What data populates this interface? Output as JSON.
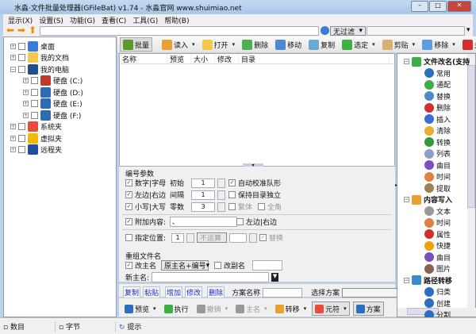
{
  "window": {
    "title": "水淼·文件批量处理器(GFileBat) v1.74 - 水淼官网 www.shuimiao.net"
  },
  "menu": [
    "显示(X)",
    "设置(S)",
    "功能(G)",
    "查看(C)",
    "工具(G)",
    "帮助(B)"
  ],
  "address": {
    "filter": "无过滤",
    "path": ""
  },
  "tree": [
    {
      "label": "桌面",
      "level": 0,
      "color": "#3a7bd5"
    },
    {
      "label": "我的文档",
      "level": 0,
      "color": "#f2c94c"
    },
    {
      "label": "我的电脑",
      "level": 0,
      "color": "#1f4f8f"
    },
    {
      "label": "硬盘 (C:)",
      "level": 1,
      "color": "#c0392b"
    },
    {
      "label": "硬盘 (D:)",
      "level": 1,
      "color": "#2d6cb5"
    },
    {
      "label": "硬盘 (E:)",
      "level": 1,
      "color": "#2d6cb5"
    },
    {
      "label": "硬盘 (F:)",
      "level": 1,
      "color": "#2d6cb5"
    },
    {
      "label": "系统夹",
      "level": 0,
      "color": "#e74c3c"
    },
    {
      "label": "虚拟夹",
      "level": 0,
      "color": "#f5b800"
    },
    {
      "label": "远程夹",
      "level": 0,
      "color": "#1f4fa0"
    }
  ],
  "toolbar": [
    {
      "label": "批量",
      "icon": "list-icon",
      "color": "#5a9a2a",
      "dropdown": false
    },
    {
      "label": "读入",
      "icon": "read-icon",
      "color": "#e8a030",
      "dropdown": true
    },
    {
      "label": "打开",
      "icon": "folder-icon",
      "color": "#f2c94c",
      "dropdown": true
    },
    {
      "label": "删除",
      "icon": "recycle-icon",
      "color": "#4caf50",
      "dropdown": false
    },
    {
      "label": "移动",
      "icon": "move-icon",
      "color": "#4a8ad0",
      "dropdown": false
    },
    {
      "label": "复制",
      "icon": "copy-icon",
      "color": "#6aaad8",
      "dropdown": false
    },
    {
      "label": "选定",
      "icon": "check-icon",
      "color": "#3cb043",
      "dropdown": true
    },
    {
      "label": "剪贴",
      "icon": "clipboard-icon",
      "color": "#d8b070",
      "dropdown": true
    },
    {
      "label": "移除",
      "icon": "eraser-icon",
      "color": "#5aa0e0",
      "dropdown": true
    },
    {
      "label": "关",
      "icon": "info-icon",
      "color": "#d32f2f",
      "dropdown": false
    }
  ],
  "list": {
    "columns": [
      "名称",
      "预览",
      "大小",
      "修改",
      "目录"
    ]
  },
  "params": {
    "section_title": "编号参数",
    "opt1": "数字|字母",
    "opt2": "左边|右边",
    "opt3": "小写|大写",
    "start_label": "初始",
    "start": "1",
    "step_label": "间隔",
    "step": "1",
    "zeros_label": "零数",
    "zeros": "3",
    "auto_align": "自动校准队形",
    "keep_dir": "保持目录独立",
    "trad": "繁体",
    "full": "全角",
    "append_label": "附加内容:",
    "append_value": "、",
    "append_side": "左边|右边",
    "pos_label": "指定位置:",
    "pos_value": "1",
    "pos_op": "不运算",
    "replace": "替换",
    "rename_title": "重组文件名",
    "main_name": "改主名",
    "main_mode": "原主名+编号",
    "ext_name": "改副名",
    "new_main_label": "新主名:",
    "new_main_value": ""
  },
  "scheme": {
    "buttons": [
      "复制",
      "粘贴",
      "增加",
      "修改",
      "删除"
    ],
    "name_label": "方案名称",
    "name_value": "",
    "select_label": "选择方案",
    "select_value": ""
  },
  "bottom": [
    {
      "label": "预览",
      "color": "#2a6fc0",
      "dropdown": true,
      "disabled": false
    },
    {
      "label": "执行",
      "color": "#3cb043",
      "dropdown": false,
      "disabled": false
    },
    {
      "label": "撤销",
      "color": "#999",
      "dropdown": true,
      "disabled": true
    },
    {
      "label": "主名",
      "color": "#999",
      "dropdown": true,
      "disabled": true
    },
    {
      "label": "转移",
      "color": "#e8a030",
      "dropdown": true,
      "disabled": false
    },
    {
      "label": "元符",
      "color": "#e74c3c",
      "dropdown": true,
      "disabled": false
    },
    {
      "label": "方案",
      "color": "#2a6fc0",
      "dropdown": false,
      "disabled": false
    }
  ],
  "functions": [
    {
      "group": "文件改名(支持",
      "color": "#3cb043",
      "items": [
        {
          "label": "常用",
          "color": "#2a6fc0"
        },
        {
          "label": "通配",
          "color": "#3cb043"
        },
        {
          "label": "替换",
          "color": "#4a8ad0"
        },
        {
          "label": "删除",
          "color": "#d32f2f"
        },
        {
          "label": "插入",
          "color": "#3a6fd0"
        },
        {
          "label": "清除",
          "color": "#e8b030"
        },
        {
          "label": "转换",
          "color": "#2e9a3a"
        },
        {
          "label": "列表",
          "color": "#8aa0c8"
        },
        {
          "label": "曲目",
          "color": "#7b4fc0"
        },
        {
          "label": "时间",
          "color": "#e08040"
        },
        {
          "label": "提取",
          "color": "#a08050"
        }
      ]
    },
    {
      "group": "内容写入",
      "color": "#e8a030",
      "items": [
        {
          "label": "文本",
          "color": "#999"
        },
        {
          "label": "时间",
          "color": "#e08040"
        },
        {
          "label": "属性",
          "color": "#d32f2f"
        },
        {
          "label": "快捷",
          "color": "#f0a000"
        },
        {
          "label": "曲目",
          "color": "#7b4fc0"
        },
        {
          "label": "图片",
          "color": "#8a6050"
        }
      ]
    },
    {
      "group": "路径转移",
      "color": "#3a8ad0",
      "items": [
        {
          "label": "归类",
          "color": "#2a6fc0"
        },
        {
          "label": "创建",
          "color": "#2a6fc0"
        },
        {
          "label": "分割",
          "color": "#2a6fc0"
        }
      ]
    }
  ],
  "status": {
    "count_label": "数目",
    "bytes_label": "字节",
    "hint_label": "提示"
  }
}
